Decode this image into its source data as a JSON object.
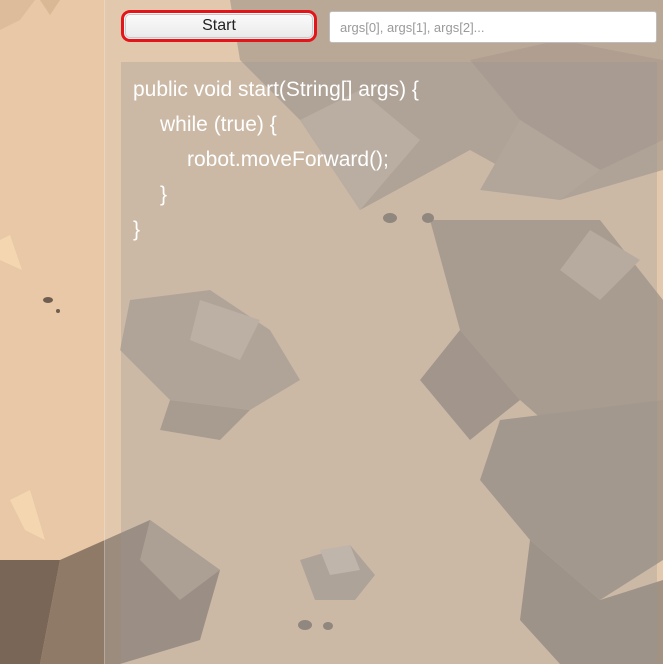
{
  "toolbar": {
    "start_label": "Start",
    "args_placeholder": "args[0], args[1], args[2]..."
  },
  "editor": {
    "lines": [
      "public void start(String[] args) {",
      "while (true) {",
      "robot.moveForward();",
      "}",
      "}"
    ]
  },
  "colors": {
    "start_button_highlight": "#e3151a",
    "code_text": "#ffffff",
    "terrain_sand": "#e6c6a4"
  }
}
